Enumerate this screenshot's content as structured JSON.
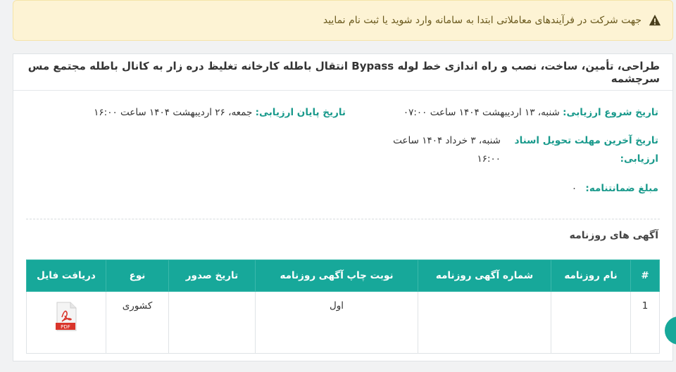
{
  "alert": {
    "icon": "warning-icon",
    "text": "جهت شرکت در فرآیندهای معاملاتی ابتدا به سامانه وارد شوید یا ثبت نام نمایید"
  },
  "tender": {
    "title": "طراحی، تأمین، ساخت، نصب و راه اندازی خط لوله Bypass انتقال باطله کارخانه تغلیظ دره زار به کانال باطله مجتمع مس سرچشمه",
    "start_label": "تاریخ شروع ارزیابی:",
    "start_value": "شنبه، ۱۳ اردیبهشت ۱۴۰۴ ساعت ۰۷:۰۰",
    "end_label": "تاریخ پایان ارزیابی:",
    "end_value": "جمعه، ۲۶ اردیبهشت ۱۴۰۴ ساعت ۱۶:۰۰",
    "deadline_label_1": "تاریخ آخرین مهلت تحویل اسناد",
    "deadline_label_2": "ارزیابی:",
    "deadline_value_1": "شنبه، ۳ خرداد ۱۴۰۴ ساعت",
    "deadline_value_2": "۱۶:۰۰",
    "guarantee_label": "مبلغ ضمانتنامه:",
    "guarantee_value": "۰"
  },
  "ads": {
    "section_title": "آگهی های روزنامه",
    "headers": {
      "num": "#",
      "newspaper": "نام روزنامه",
      "ad_number": "شماره آگهی روزنامه",
      "print_round": "نوبت چاپ آگهی روزنامه",
      "issue_date": "تاریخ صدور",
      "type": "نوع",
      "file": "دریافت فایل"
    },
    "rows": [
      {
        "num": "1",
        "newspaper": "",
        "ad_number": "",
        "print_round": "اول",
        "issue_date": "",
        "type": "کشوری",
        "file_icon": "pdf-icon",
        "file_badge": "PDF"
      }
    ]
  }
}
